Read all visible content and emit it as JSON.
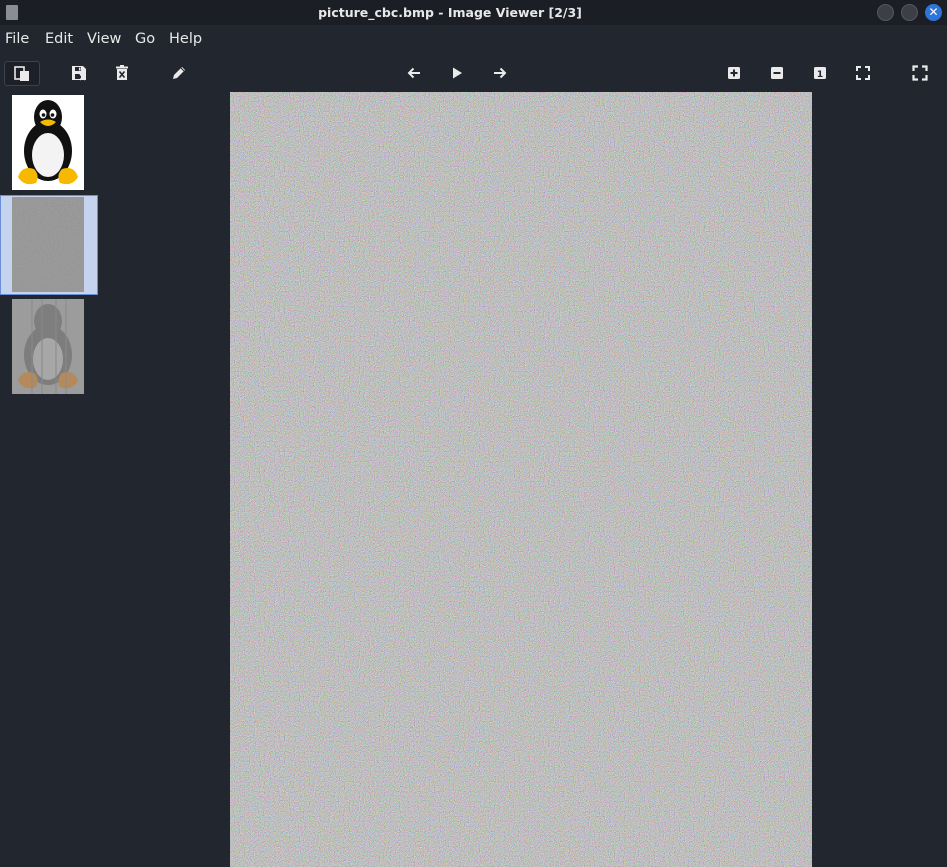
{
  "window": {
    "title": "picture_cbc.bmp - Image Viewer [2/3]",
    "close_symbol": "✕"
  },
  "menu": {
    "items": [
      "File",
      "Edit",
      "View",
      "Go",
      "Help"
    ]
  },
  "toolbar": {
    "buttons": [
      {
        "name": "thumbnails-toggle",
        "icon": "thumbnails-icon"
      },
      {
        "name": "save",
        "icon": "save-icon"
      },
      {
        "name": "delete",
        "icon": "delete-icon"
      },
      {
        "name": "edit",
        "icon": "pencil-icon"
      },
      {
        "name": "previous",
        "icon": "arrow-left-icon"
      },
      {
        "name": "slideshow",
        "icon": "play-icon"
      },
      {
        "name": "next",
        "icon": "arrow-right-icon"
      },
      {
        "name": "zoom-in",
        "icon": "zoom-in-icon"
      },
      {
        "name": "zoom-out",
        "icon": "zoom-out-icon"
      },
      {
        "name": "normal-size",
        "icon": "normal-size-icon",
        "label": "1"
      },
      {
        "name": "best-fit",
        "icon": "best-fit-icon"
      },
      {
        "name": "fullscreen",
        "icon": "fullscreen-icon"
      }
    ]
  },
  "thumbnails": [
    {
      "content": "tux-penguin-icon",
      "selected": false
    },
    {
      "content": "noise-gray",
      "selected": true
    },
    {
      "content": "faded-tux-penguin",
      "selected": false
    }
  ],
  "colors": {
    "background": "#22262f",
    "titlebar": "#1b1e25",
    "selection": "#c5d3ee",
    "selection_border": "#6b8fd6",
    "close_button": "#2f74d8"
  }
}
